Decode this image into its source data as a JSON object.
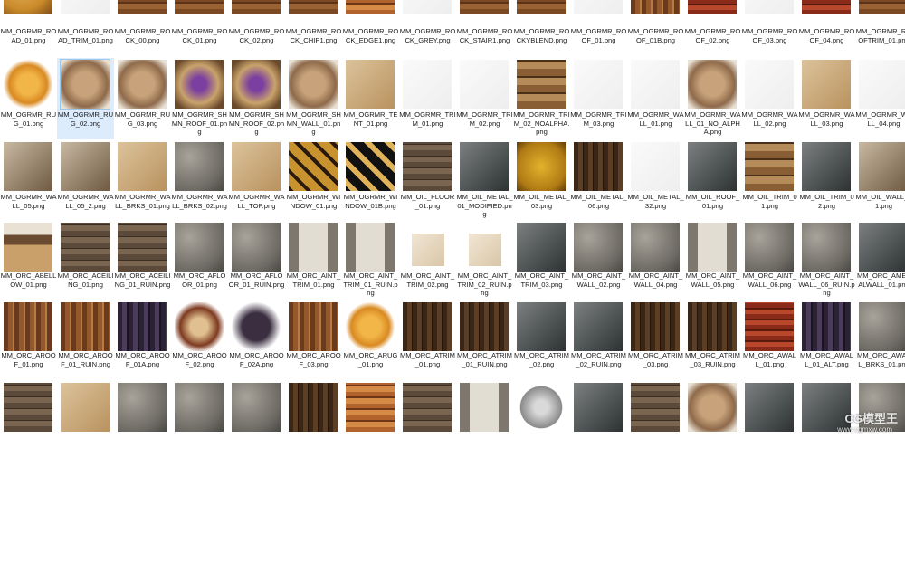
{
  "watermark": {
    "text": "CG模型王",
    "sub": "www.cgmxw.com"
  },
  "rows": [
    {
      "top_thumb": -38,
      "label_top": 30,
      "items": [
        {
          "name": "MM_OGRMR_ROAD_01.png",
          "kind": "road"
        },
        {
          "name": "MM_OGRMR_ROAD_TRIM_01.png",
          "kind": "white"
        },
        {
          "name": "MM_OGRMR_ROCK_00.png",
          "kind": "wood"
        },
        {
          "name": "MM_OGRMR_ROCK_01.png",
          "kind": "wood"
        },
        {
          "name": "MM_OGRMR_ROCK_02.png",
          "kind": "wood"
        },
        {
          "name": "MM_OGRMR_ROCK_CHIP1.png",
          "kind": "wood"
        },
        {
          "name": "MM_OGRMR_ROCK_EDGE1.png",
          "kind": "rust"
        },
        {
          "name": "MM_OGRMR_ROCK_GREY.png",
          "kind": "white"
        },
        {
          "name": "MM_OGRMR_ROCK_STAIR1.png",
          "kind": "wood"
        },
        {
          "name": "MM_OGRMR_ROCKYBLEND.png",
          "kind": "wood"
        },
        {
          "name": "MM_OGRMR_ROOF_01.png",
          "kind": "white"
        },
        {
          "name": "MM_OGRMR_ROOF_01B.png",
          "kind": "roof"
        },
        {
          "name": "MM_OGRMR_ROOF_02.png",
          "kind": "roofred"
        },
        {
          "name": "MM_OGRMR_ROOF_03.png",
          "kind": "white"
        },
        {
          "name": "MM_OGRMR_ROOF_04.png",
          "kind": "roofred"
        },
        {
          "name": "MM_OGRMR_ROOFTRIM_01.png",
          "kind": "wood"
        }
      ]
    },
    {
      "top_thumb": 66,
      "label_top": 122,
      "items": [
        {
          "name": "MM_OGRMR_RUG_01.png",
          "kind": "rug"
        },
        {
          "name": "MM_OGRMR_RUG_02.png",
          "kind": "fur",
          "selected": true
        },
        {
          "name": "MM_OGRMR_RUG_03.png",
          "kind": "fur"
        },
        {
          "name": "MM_OGRMR_SHMN_ROOF_01.png",
          "kind": "shaman"
        },
        {
          "name": "MM_OGRMR_SHMN_ROOF_02.png",
          "kind": "shaman"
        },
        {
          "name": "MM_OGRMR_SHMN_WALL_01.png",
          "kind": "fur"
        },
        {
          "name": "MM_OGRMR_TENT_01.png",
          "kind": "tent"
        },
        {
          "name": "MM_OGRMR_TRIM_01.png",
          "kind": "white"
        },
        {
          "name": "MM_OGRMR_TRIM_02.png",
          "kind": "white"
        },
        {
          "name": "MM_OGRMR_TRIM_02_NOALPHA.png",
          "kind": "crate"
        },
        {
          "name": "MM_OGRMR_TRIM_03.png",
          "kind": "white"
        },
        {
          "name": "MM_OGRMR_WALL_01.png",
          "kind": "white"
        },
        {
          "name": "MM_OGRMR_WALL_01_NO_ALPHA.png",
          "kind": "fur"
        },
        {
          "name": "MM_OGRMR_WALL_02.png",
          "kind": "white"
        },
        {
          "name": "MM_OGRMR_WALL_03.png",
          "kind": "tent"
        },
        {
          "name": "MM_OGRMR_WALL_04.png",
          "kind": "white"
        }
      ]
    },
    {
      "top_thumb": 157,
      "label_top": 213,
      "items": [
        {
          "name": "MM_OGRMR_WALL_05.png",
          "kind": "wall"
        },
        {
          "name": "MM_OGRMR_WALL_05_2.png",
          "kind": "wall"
        },
        {
          "name": "MM_OGRMR_WALL_BRKS_01.png",
          "kind": "tent"
        },
        {
          "name": "MM_OGRMR_WALL_BRKS_02.png",
          "kind": "stone"
        },
        {
          "name": "MM_OGRMR_WALL_TOP.png",
          "kind": "tent"
        },
        {
          "name": "MM_OGRMR_WINDOW_01.png",
          "kind": "window"
        },
        {
          "name": "MM_OGRMR_WINDOW_01B.png",
          "kind": "windowdark"
        },
        {
          "name": "MM_OIL_FLOOR_01.png",
          "kind": "planks"
        },
        {
          "name": "MM_OIL_METAL_01_MODIFIED.png",
          "kind": "metal"
        },
        {
          "name": "MM_OIL_METAL_03.png",
          "kind": "yellow"
        },
        {
          "name": "MM_OIL_METAL_06.png",
          "kind": "darkwood"
        },
        {
          "name": "MM_OIL_METAL_32.png",
          "kind": "white"
        },
        {
          "name": "MM_OIL_ROOF_01.png",
          "kind": "metal"
        },
        {
          "name": "MM_OIL_TRIM_01.png",
          "kind": "crate"
        },
        {
          "name": "MM_OIL_TRIM_02.png",
          "kind": "metal"
        },
        {
          "name": "MM_OIL_WALL_01.png",
          "kind": "wall"
        }
      ]
    },
    {
      "top_thumb": 246,
      "label_top": 300,
      "items": [
        {
          "name": "MM_ORC_ABELLOW_01.png",
          "kind": "bellow"
        },
        {
          "name": "MM_ORC_ACEILING_01.png",
          "kind": "planks"
        },
        {
          "name": "MM_ORC_ACEILING_01_RUIN.png",
          "kind": "planks"
        },
        {
          "name": "MM_ORC_AFLOOR_01.png",
          "kind": "stone"
        },
        {
          "name": "MM_ORC_AFLOOR_01_RUIN.png",
          "kind": "stone"
        },
        {
          "name": "MM_ORC_AINT_TRIM_01.png",
          "kind": "bone"
        },
        {
          "name": "MM_ORC_AINT_TRIM_01_RUIN.png",
          "kind": "bone"
        },
        {
          "name": "MM_ORC_AINT_TRIM_02.png",
          "kind": "small"
        },
        {
          "name": "MM_ORC_AINT_TRIM_02_RUIN.png",
          "kind": "small"
        },
        {
          "name": "MM_ORC_AINT_TRIM_03.png",
          "kind": "metal"
        },
        {
          "name": "MM_ORC_AINT_WALL_02.png",
          "kind": "stone"
        },
        {
          "name": "MM_ORC_AINT_WALL_04.png",
          "kind": "stone"
        },
        {
          "name": "MM_ORC_AINT_WALL_05.png",
          "kind": "bone"
        },
        {
          "name": "MM_ORC_AINT_WALL_06.png",
          "kind": "stone"
        },
        {
          "name": "MM_ORC_AINT_WALL_06_RUIN.png",
          "kind": "stone"
        },
        {
          "name": "MM_ORC_AMETALWALL_01.png",
          "kind": "metal"
        }
      ]
    },
    {
      "top_thumb": 334,
      "label_top": 388,
      "items": [
        {
          "name": "MM_ORC_AROOF_01.png",
          "kind": "roof"
        },
        {
          "name": "MM_ORC_AROOF_01_RUIN.png",
          "kind": "roof"
        },
        {
          "name": "MM_ORC_AROOF_01A.png",
          "kind": "purpleroof"
        },
        {
          "name": "MM_ORC_AROOF_02.png",
          "kind": "ruin"
        },
        {
          "name": "MM_ORC_AROOF_02A.png",
          "kind": "ruindark"
        },
        {
          "name": "MM_ORC_AROOF_03.png",
          "kind": "roof"
        },
        {
          "name": "MM_ORC_ARUG_01.png",
          "kind": "rug"
        },
        {
          "name": "MM_ORC_ATRIM_01.png",
          "kind": "darkwood"
        },
        {
          "name": "MM_ORC_ATRIM_01_RUIN.png",
          "kind": "darkwood"
        },
        {
          "name": "MM_ORC_ATRIM_02.png",
          "kind": "metal"
        },
        {
          "name": "MM_ORC_ATRIM_02_RUIN.png",
          "kind": "metal"
        },
        {
          "name": "MM_ORC_ATRIM_03.png",
          "kind": "darkwood"
        },
        {
          "name": "MM_ORC_ATRIM_03_RUIN.png",
          "kind": "darkwood"
        },
        {
          "name": "MM_ORC_AWALL_01.png",
          "kind": "roofred"
        },
        {
          "name": "MM_ORC_AWALL_01_ALT.png",
          "kind": "purpleroof"
        },
        {
          "name": "MM_ORC_AWALL_BRKS_01.png",
          "kind": "stone"
        }
      ]
    },
    {
      "top_thumb": 423,
      "label_top": 600,
      "items": [
        {
          "name": "",
          "kind": "planks"
        },
        {
          "name": "",
          "kind": "tent"
        },
        {
          "name": "",
          "kind": "stone"
        },
        {
          "name": "",
          "kind": "stone"
        },
        {
          "name": "",
          "kind": "stone"
        },
        {
          "name": "",
          "kind": "darkwood"
        },
        {
          "name": "",
          "kind": "rust"
        },
        {
          "name": "",
          "kind": "planks"
        },
        {
          "name": "",
          "kind": "bone"
        },
        {
          "name": "",
          "kind": "stud"
        },
        {
          "name": "",
          "kind": "metal"
        },
        {
          "name": "",
          "kind": "planks"
        },
        {
          "name": "",
          "kind": "fur"
        },
        {
          "name": "",
          "kind": "metal"
        },
        {
          "name": "",
          "kind": "metal"
        },
        {
          "name": "",
          "kind": "stone"
        }
      ]
    }
  ],
  "textures": {
    "road": "radial-gradient(circle at 40% 40%,#e2b25a,#c98a2a 60%,#7a4a18)",
    "white": "linear-gradient(135deg,#fafafa,#eeeeee)",
    "wood": "repeating-linear-gradient(0deg,#7b4a25 0 6px,#9a6233 6px 12px,#5c3318 12px 14px)",
    "rust": "repeating-linear-gradient(0deg,#b2622c 0 5px,#d58a45 5px 11px,#6e3616 11px 13px)",
    "roof": "repeating-linear-gradient(90deg,#6a3a1e 0 5px,#94582d 5px 10px,#b77b43 10px 12px)",
    "roofred": "repeating-linear-gradient(0deg,#8a2a18 0 5px,#b9472b 5px 10px,#5a190d 10px 12px)",
    "rug": "radial-gradient(circle,#f2b548 30%,#d98a22 55%,#ffffff 72%)",
    "fur": "radial-gradient(circle,#c7a27a 35%,#8e6a4b 65%,#e9e1d4 90%)",
    "shaman": "radial-gradient(circle,#7a3fa0 20%,#c9a36b 55%,#6b4a2c 85%)",
    "tent": "linear-gradient(135deg,#dcc39b,#b9925f)",
    "crate": "repeating-linear-gradient(0deg,#8a5e34 0 8px,#b58b5a 8px 16px,#4a3018 16px 18px)",
    "wall": "linear-gradient(135deg,#c8b9a2,#6f5a42)",
    "stone": "radial-gradient(circle at 30% 30%,#a8a39a,#6d6a64 70%,#4a4844)",
    "window": "repeating-linear-gradient(45deg,#2a1a0e 0 4px,#c8922e 4px 14px)",
    "windowdark": "repeating-linear-gradient(45deg,#111 0 4px,#e0b25a 4px 10px,#111 10px 16px)",
    "planks": "repeating-linear-gradient(0deg,#5b4a3a 0 6px,#7a6550 6px 12px,#3a2d22 12px 13px)",
    "metal": "linear-gradient(135deg,#7d8081,#4c5152 60%,#2e3233)",
    "yellow": "radial-gradient(circle,#e3b22c,#b07a14 70%,#5d3d0a)",
    "darkwood": "repeating-linear-gradient(90deg,#3a2616 0 5px,#5c3e25 5px 10px,#23160c 10px 11px)",
    "bellow": "linear-gradient(180deg,#e9e1d4 0 25%,#6a4a30 25% 45%,#c9a06a 45%)",
    "bone": "linear-gradient(90deg,#7d776d 0 20%,#e2ddd2 20% 80%,#7d776d 80%)",
    "small": "linear-gradient(135deg,#f1e6d4,#d9c6a8)",
    "purpleroof": "repeating-linear-gradient(90deg,#2b2236 0 5px,#4d3b5e 5px 10px,#1a1422 10px 12px)",
    "ruin": "radial-gradient(circle,#e0c090 25%,#7d3a20 55%,#ffffff 75%)",
    "ruindark": "radial-gradient(circle,#3a2e40 40%,#ffffff 72%)",
    "stud": "radial-gradient(circle,#d9d9d9 20%,#8a8a8a 60%,#ffffff 62%)"
  },
  "col_x": [
    0,
    63,
    126,
    189,
    252,
    315,
    378,
    441,
    504,
    567,
    630,
    693,
    756,
    819,
    882,
    945
  ]
}
